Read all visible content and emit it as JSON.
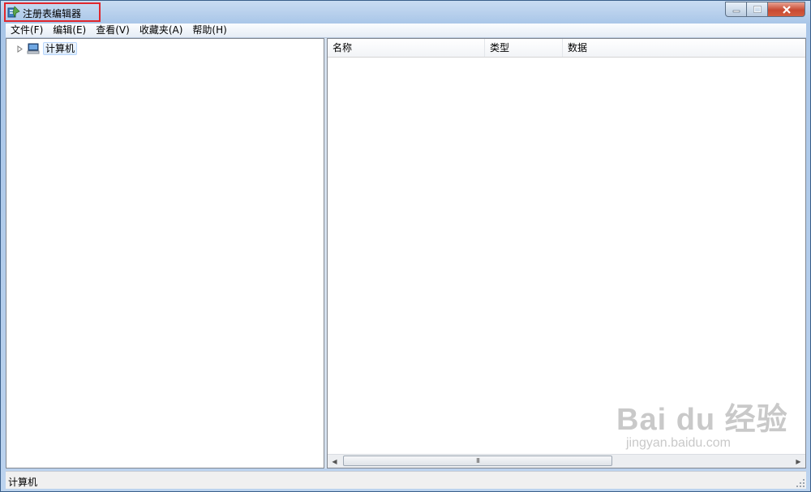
{
  "window": {
    "title": "注册表编辑器"
  },
  "menu": [
    {
      "label": "文件(F)"
    },
    {
      "label": "编辑(E)"
    },
    {
      "label": "查看(V)"
    },
    {
      "label": "收藏夹(A)"
    },
    {
      "label": "帮助(H)"
    }
  ],
  "tree": {
    "root_label": "计算机"
  },
  "list": {
    "columns": [
      "名称",
      "类型",
      "数据"
    ]
  },
  "scrollbar": {
    "thumb_glyph": "III"
  },
  "status": {
    "path": "计算机"
  },
  "watermark": {
    "main": "Bai du 经验",
    "sub": "jingyan.baidu.com"
  },
  "colors": {
    "highlight_border": "#e0262c",
    "close_button": "#c84a32"
  }
}
